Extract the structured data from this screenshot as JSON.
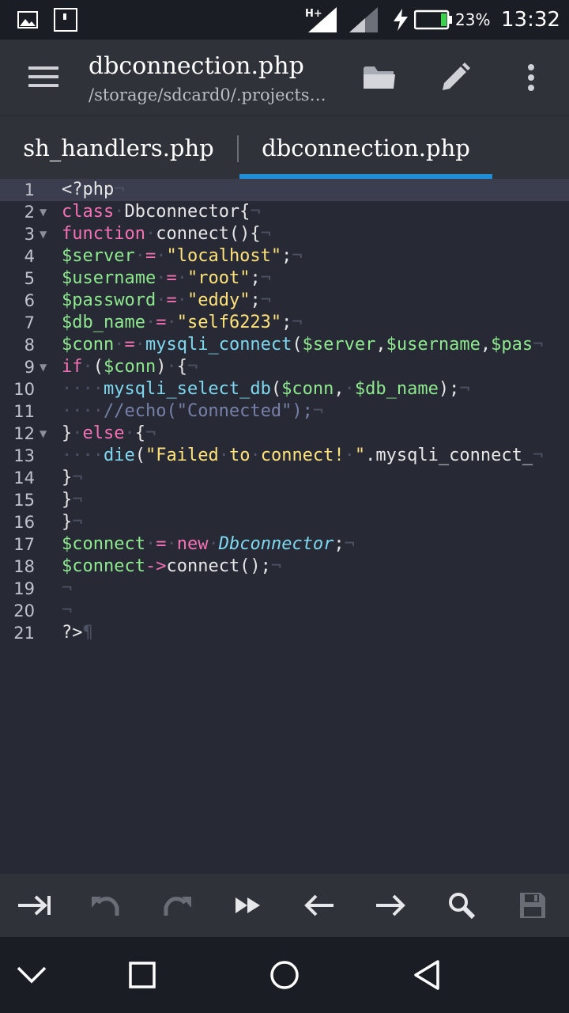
{
  "status_bar": {
    "network_type": "H+",
    "battery_percent": "23%",
    "time": "13:32"
  },
  "toolbar": {
    "title": "dbconnection.php",
    "path": "/storage/sdcard0/.projects…"
  },
  "tabs": [
    {
      "label": "sh_handlers.php",
      "active": false
    },
    {
      "label": "dbconnection.php",
      "active": true
    }
  ],
  "editor": {
    "line_numbers": [
      "1",
      "2",
      "3",
      "4",
      "5",
      "6",
      "7",
      "8",
      "9",
      "10",
      "11",
      "12",
      "13",
      "14",
      "15",
      "16",
      "17",
      "18",
      "19",
      "20",
      "21"
    ],
    "lines": [
      "<?php",
      "class Dbconnector{",
      "function connect(){",
      "$server = \"localhost\";",
      "$username = \"root\";",
      "$password = \"eddy\";",
      "$db_name = \"self6223\";",
      "$conn = mysqli_connect($server,$username,$pas",
      "if ($conn) {",
      "    mysqli_select_db($conn, $db_name);",
      "    //echo(\"Connected\");",
      "} else {",
      "    die(\"Failed to connect! \".mysqli_connect_",
      "}",
      "}",
      "}",
      "$connect = new Dbconnector;",
      "$connect->connect();",
      "",
      "",
      "?>"
    ]
  },
  "colors": {
    "keyword": "#f471b5",
    "variable": "#8ee98e",
    "string": "#ffe27a",
    "function": "#7fd8f0",
    "comment": "#7780a6",
    "accent": "#1e8fd6"
  }
}
